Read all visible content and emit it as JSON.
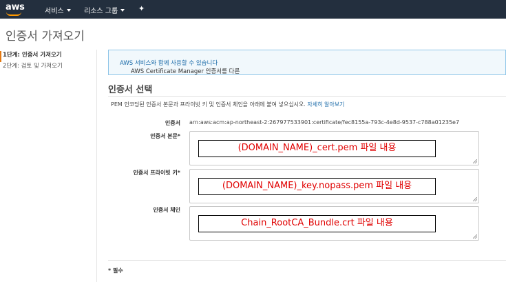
{
  "header": {
    "logo_text": "aws",
    "services_label": "서비스",
    "resource_groups_label": "리소스 그룹",
    "pin_glyph": "✦"
  },
  "page": {
    "title": "인증서 가져오기"
  },
  "steps": [
    {
      "label": "1단계: 인증서 가져오기",
      "active": true
    },
    {
      "label": "2단계: 검토 및 가져오기",
      "active": false
    }
  ],
  "info": {
    "text_before": "AWS Certificate Manager 인증서를 다른 ",
    "link_text": "AWS 서비스와 함께 사용할 수 있습니다",
    "text_after": "."
  },
  "section": {
    "title": "인증서 선택",
    "description": "PEM 인코딩된 인증서 본문과 프라이빗 키 및 인증서 체인을 아래에 붙여 넣으십시오. ",
    "learn_more": "자세히 알아보기"
  },
  "form": {
    "arn_label": "인증서",
    "arn_value": "arn:aws:acm:ap-northeast-2:267977533901:certificate/fec8155a-793c-4e8d-9537-c788a01235e7",
    "body_label": "인증서 본문*",
    "key_label": "인증서 프라이빗 키*",
    "chain_label": "인증서 체인"
  },
  "annotations": {
    "body": "(DOMAIN_NAME)_cert.pem  파일 내용",
    "key": "(DOMAIN_NAME)_key.nopass.pem  파일 내용",
    "chain": "Chain_RootCA_Bundle.crt  파일 내용"
  },
  "footer": {
    "required_note": "* 필수"
  },
  "colors": {
    "topbar": "#232f3e",
    "accent": "#ff9900",
    "active_step_border": "#e47911",
    "link": "#1a6aa8",
    "info_bg": "#f1f8fc",
    "annotation_text": "#e00000"
  }
}
